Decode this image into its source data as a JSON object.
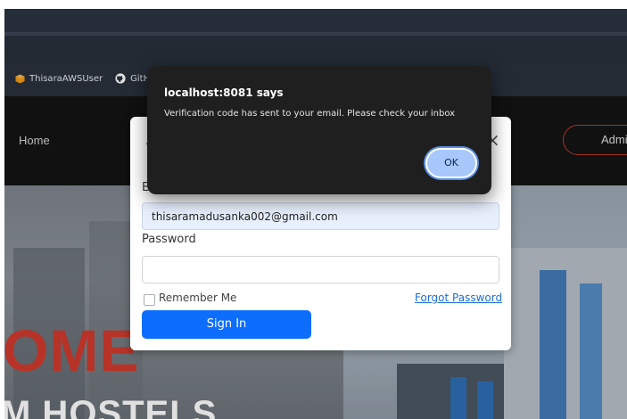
{
  "browser": {
    "bookmarks": [
      {
        "label": "ThisaraAWSUser",
        "icon": "aws-cube-icon",
        "color": "#f39c12"
      },
      {
        "label": "GitH",
        "icon": "github-icon",
        "color": "#ffffff"
      }
    ]
  },
  "site": {
    "nav_home": "Home",
    "nav_admin": "Admi",
    "hero_title_line1": "OME",
    "hero_title_line2": "M HOSTELS",
    "accent_color": "#d13b2e"
  },
  "login_modal": {
    "title_initial": "A",
    "close_symbol": "×",
    "email_label_initial": "E",
    "email_value": "thisaramadusanka002@gmail.com",
    "password_label": "Password",
    "password_value": "",
    "remember_label": "Remember Me",
    "forgot_label": "Forgot Password",
    "signin_label": "Sign In",
    "primary_color": "#0d6efd"
  },
  "alert_dialog": {
    "title": "localhost:8081 says",
    "message": "Verification code has sent to your email. Please check your inbox",
    "ok_label": "OK"
  }
}
